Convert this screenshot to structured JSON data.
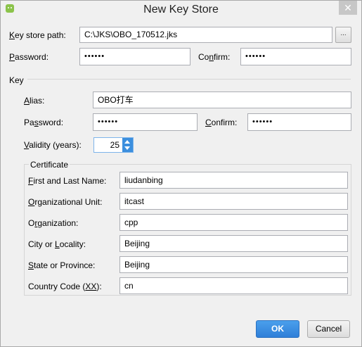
{
  "window": {
    "title": "New Key Store"
  },
  "keystore": {
    "path_label_u": "K",
    "path_label_rest": "ey store path:",
    "path_value": "C:\\JKS\\OBO_170512.jks",
    "browse_label": "...",
    "password_label_u": "P",
    "password_label_rest": "assword:",
    "password_value": "••••••",
    "confirm_label_pre": "Co",
    "confirm_label_u": "n",
    "confirm_label_rest": "firm:",
    "confirm_value": "••••••"
  },
  "key": {
    "section_label": "Key",
    "alias_label_u": "A",
    "alias_label_rest": "lias:",
    "alias_value": "OBO打车",
    "password_label_pre": "Pa",
    "password_label_u": "s",
    "password_label_rest": "sword:",
    "password_value": "••••••",
    "confirm_label_u": "C",
    "confirm_label_rest": "onfirm:",
    "confirm_value": "••••••",
    "validity_label_u": "V",
    "validity_label_rest": "alidity (years):",
    "validity_value": "25"
  },
  "certificate": {
    "section_label": "Certificate",
    "fields": [
      {
        "label_pre": "",
        "label_u": "F",
        "label_rest": "irst and Last Name:",
        "value": "liudanbing"
      },
      {
        "label_pre": "",
        "label_u": "O",
        "label_rest": "rganizational Unit:",
        "value": "itcast"
      },
      {
        "label_pre": "O",
        "label_u": "r",
        "label_rest": "ganization:",
        "value": "cpp"
      },
      {
        "label_pre": "City or ",
        "label_u": "L",
        "label_rest": "ocality:",
        "value": "Beijing"
      },
      {
        "label_pre": "",
        "label_u": "S",
        "label_rest": "tate or Province:",
        "value": "Beijing"
      },
      {
        "label_pre": "Country Code (",
        "label_u": "XX",
        "label_rest": "):",
        "value": "cn"
      }
    ]
  },
  "buttons": {
    "ok": "OK",
    "cancel": "Cancel"
  },
  "colors": {
    "accent": "#2f7fd8",
    "spinner": "#3c8fde",
    "close_button": "#c7c7c7"
  },
  "icons": {
    "app": "android-icon",
    "close": "close-icon",
    "spinner_up": "chevron-up-icon",
    "spinner_down": "chevron-down-icon"
  }
}
